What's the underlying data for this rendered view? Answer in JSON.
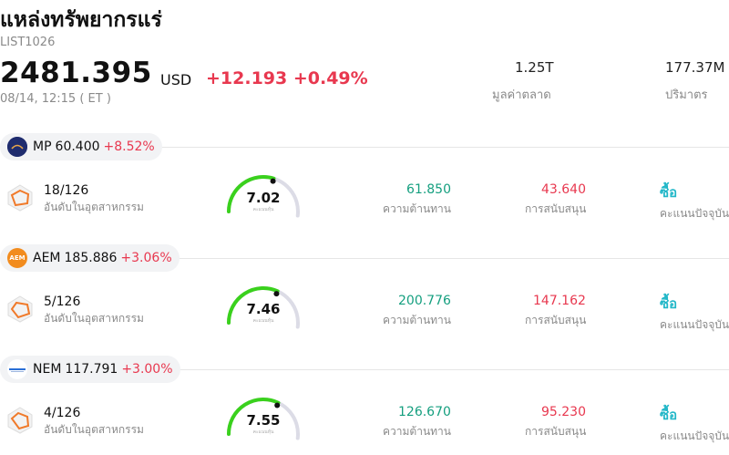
{
  "header": {
    "title": "แหล่งทรัพยากรแร่",
    "code": "LIST1026",
    "price": "2481.395",
    "currency": "USD",
    "change": "+12.193 +0.49%",
    "time": "08/14, 12:15  ( ET )",
    "market_cap_value": "1.25T",
    "market_cap_label": "มูลค่าตลาด",
    "volume_value": "177.37M",
    "volume_label": "ปริมาตร"
  },
  "stocks": [
    {
      "ticker": "MP",
      "price": "60.400",
      "change": "+8.52%",
      "rank": "18/126",
      "rank_label": "อันดับในอุตสาหกรรม",
      "score": "7.02",
      "score_sub": "คะแนนหุ้น",
      "score_value": 7.02,
      "resistance": "61.850",
      "resistance_label": "ความต้านทาน",
      "support": "43.640",
      "support_label": "การสนับสนุน",
      "action": "ซื้อ",
      "action_label": "คะแนนปัจจุบัน",
      "logo_color": "#2b3a8c",
      "logo_icon": "mp-logo-icon"
    },
    {
      "ticker": "AEM",
      "price": "185.886",
      "change": "+3.06%",
      "rank": "5/126",
      "rank_label": "อันดับในอุตสาหกรรม",
      "score": "7.46",
      "score_sub": "คะแนนหุ้น",
      "score_value": 7.46,
      "resistance": "200.776",
      "resistance_label": "ความต้านทาน",
      "support": "147.162",
      "support_label": "การสนับสนุน",
      "action": "ซื้อ",
      "action_label": "คะแนนปัจจุบัน",
      "logo_color": "#f28c1e",
      "logo_icon": "aem-logo-icon",
      "logo_text": "AEM"
    },
    {
      "ticker": "NEM",
      "price": "117.791",
      "change": "+3.00%",
      "rank": "4/126",
      "rank_label": "อันดับในอุตสาหกรรม",
      "score": "7.55",
      "score_sub": "คะแนนหุ้น",
      "score_value": 7.55,
      "resistance": "126.670",
      "resistance_label": "ความต้านทาน",
      "support": "95.230",
      "support_label": "การสนับสนุน",
      "action": "ซื้อ",
      "action_label": "คะแนนปัจจุบัน",
      "logo_color": "#ffffff",
      "logo_icon": "nem-logo-icon"
    }
  ],
  "colors": {
    "up_red": "#e8384f",
    "green": "#159f7f",
    "buy": "#22b7c8",
    "gauge_green": "#3ad11d",
    "radar_orange": "#f07a2a"
  }
}
